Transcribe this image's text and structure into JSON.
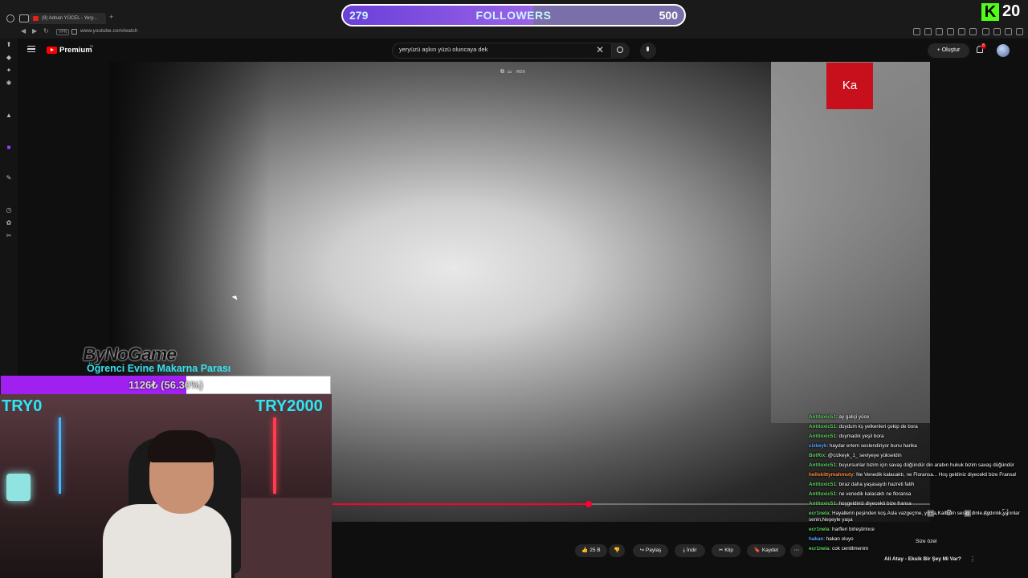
{
  "browser": {
    "tab_title": "(8) Adnan YÜCEL - Yery...",
    "url": "www.youtube.com/watch",
    "vpn_label": "VPN"
  },
  "followers_goal": {
    "current": "279",
    "label": "FOLLOWERS",
    "target": "500",
    "progress": 0.558
  },
  "kick": {
    "logo": "K",
    "viewer_count": "20"
  },
  "youtube": {
    "brand": "Premium",
    "brand_tm": "TR",
    "search_query": "yeryüzü aşkın yüzü oluncaya dek",
    "create_label": "Oluştur",
    "notif_count": "8",
    "player_badge": "Ka",
    "player_top_label": "ROX",
    "progress": 0.429,
    "actions": {
      "likes": "25 B",
      "share": "Paylaş",
      "download": "İndir",
      "clip": "Klip",
      "save": "Kaydet"
    },
    "suggest_title": "Ali Atay - Eksik Bir Şey Mi Var?",
    "suggest_tab": "Size özel"
  },
  "overlay": {
    "sponsor_logo": "ByNoGame",
    "donation_title": "Öğrenci Evine Makarna Parası",
    "donation_progress_text": "1126₺ (56.30%)",
    "donation_progress": 0.563,
    "donation_min": "TRY0",
    "donation_max": "TRY2000"
  },
  "chat": [
    {
      "user": "Antitoxic51",
      "text": ": ay galiçi yüce",
      "color": "#5fd35f"
    },
    {
      "user": "Antitoxic51",
      "text": ": duydum kş yelkenleri çekip de bora",
      "color": "#5fd35f"
    },
    {
      "user": "Antitoxic51",
      "text": ": duymadık yeşil bora",
      "color": "#5fd35f"
    },
    {
      "user": "cizkeyk",
      "text": ": haydar ertem seslendiriyor bunu harika",
      "color": "#55a9ff"
    },
    {
      "user": "BotRix",
      "text": ": @cizkeyk_1_ seviyeye yükseldin",
      "color": "#5fd35f"
    },
    {
      "user": "Antitoxic51",
      "text": ": buyursunlar bizim için savaş düğündür din arabın hukuk bizim savaş düğündür",
      "color": "#5fd35f"
    },
    {
      "user": "hellokittymahmuty",
      "text": ": Ne Venedik kalacaktı, ne Floransa... Hoş geldiniz diyecekti bize Fransa!",
      "color": "#ff8c3a"
    },
    {
      "user": "Antitoxic51",
      "text": ": biraz daha yaşasaydı hazreti fatih",
      "color": "#5fd35f"
    },
    {
      "user": "Antitoxic51",
      "text": ": ne venedik kalacaktı ne floransa",
      "color": "#5fd35f"
    },
    {
      "user": "Antitoxic51",
      "text": ": hoşgeldiniz diyecekti bize fransa",
      "color": "#5fd35f"
    },
    {
      "user": "ecr1nela",
      "text": ": Hayallerin peşinden koş.Asla vazgeçme, yılma,Kalbinin sesini dinle.Aydınlık yarınlar senin,Neşeyle yaşa",
      "color": "#5fd35f"
    },
    {
      "user": "ecr1nela",
      "text": ": harfleri birleştirince",
      "color": "#5fd35f"
    },
    {
      "user": "hakan",
      "text": ": hakan oluyo",
      "color": "#55a9ff"
    },
    {
      "user": "ecr1nela",
      "text": ": cok centilmenim",
      "color": "#5fd35f"
    }
  ],
  "colors": {
    "youtube_red": "#ff0000",
    "kick_green": "#53fc18",
    "donation_purple": "#a020f0",
    "overlay_cyan": "#2ee6f3",
    "progress_red": "#ff0033"
  }
}
